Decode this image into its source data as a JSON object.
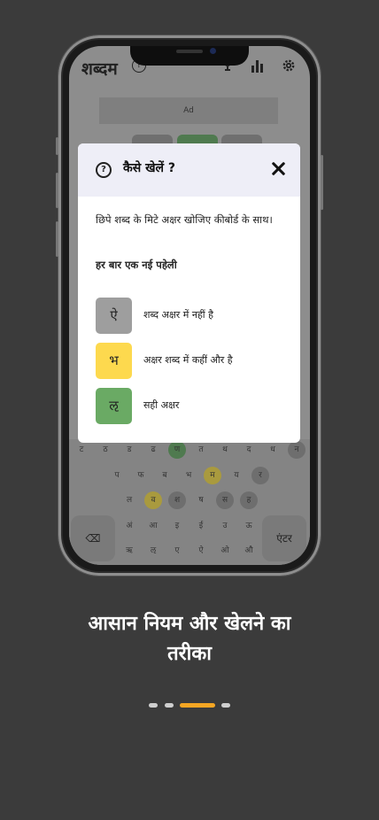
{
  "app": {
    "title": "शब्दम",
    "help_glyph": "?",
    "ad_label": "Ad"
  },
  "keyboard": {
    "row1": [
      "ट",
      "ठ",
      "ड",
      "ढ",
      "ण",
      "त",
      "थ",
      "द",
      "ध",
      "न"
    ],
    "row2": [
      "प",
      "फ",
      "ब",
      "भ",
      "म",
      "य",
      "र"
    ],
    "row3": [
      "ल",
      "व",
      "श",
      "ष",
      "स",
      "ह"
    ],
    "row4": [
      "अं",
      "आ",
      "इ",
      "ई",
      "उ",
      "ऊ"
    ],
    "row5": [
      "ऋ",
      "ऌ",
      "ए",
      "ऐ",
      "ओ",
      "औ"
    ],
    "enter_label": "एंटर",
    "backspace_glyph": "⌫"
  },
  "modal": {
    "title": "कैसे खेलें ?",
    "help_glyph": "?",
    "intro": "छिपे शब्द के मिटे अक्षर खोजिए कीबोर्ड के साथ।",
    "subhead": "हर बार एक नई पहेली",
    "examples": [
      {
        "letter": "ऐ",
        "label": "शब्द अक्षर में नहीं है",
        "color": "#9e9e9e"
      },
      {
        "letter": "भ",
        "label": "अक्षर शब्द में कहीं और है",
        "color": "#fdd94e"
      },
      {
        "letter": "ऌ",
        "label": "सही अक्षर",
        "color": "#6aaa64"
      }
    ]
  },
  "caption": {
    "line1": "आसान नियम और खेलने का",
    "line2": "तरीका"
  },
  "pager": {
    "total": 4,
    "active_index": 2,
    "active_color": "#f5a623"
  }
}
